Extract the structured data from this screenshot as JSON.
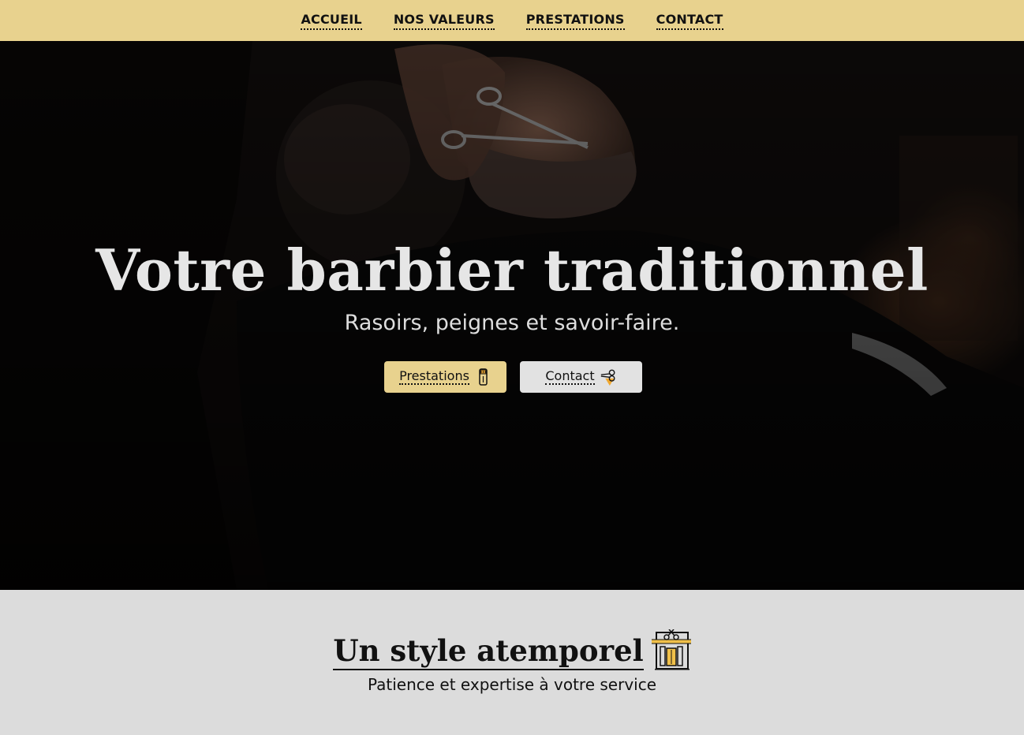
{
  "nav": {
    "items": [
      {
        "label": "ACCUEIL"
      },
      {
        "label": "NOS VALEURS"
      },
      {
        "label": "PRESTATIONS"
      },
      {
        "label": "CONTACT"
      }
    ]
  },
  "hero": {
    "title": "Votre barbier traditionnel",
    "subtitle": "Rasoirs, peignes et savoir-faire.",
    "buttons": {
      "prestations": {
        "label": "Prestations",
        "icon": "razor-icon"
      },
      "contact": {
        "label": "Contact",
        "icon": "scissors-icon"
      }
    },
    "image": "barber-trimming-beard-photo"
  },
  "section": {
    "title": "Un style atemporel",
    "title_icon": "barbershop-storefront-icon",
    "subtitle": "Patience et expertise à votre service"
  },
  "colors": {
    "accent": "#e8d28e",
    "section_bg": "#dcdcdc",
    "hero_text": "#e6e6e6",
    "icon_orange": "#f0a830"
  }
}
